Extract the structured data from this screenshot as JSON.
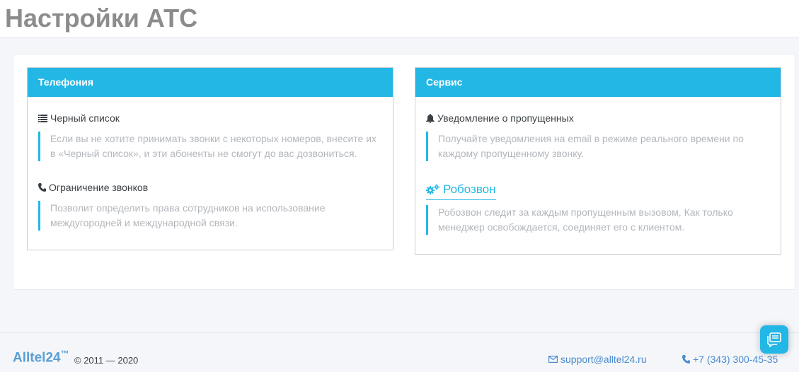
{
  "header": {
    "title": "Настройки АТС"
  },
  "telephony": {
    "heading": "Телефония",
    "items": [
      {
        "title": "Черный список",
        "icon": "list-icon",
        "description": "Если вы не хотите принимать звонки с некоторых номеров, внесите их в «Черный список», и эти абоненты не смогут до вас дозвониться."
      },
      {
        "title": "Ограничение звонков",
        "icon": "phone-icon",
        "description": "Позволит определить права сотрудников на использование междугородней и международной связи."
      }
    ]
  },
  "service": {
    "heading": "Сервис",
    "items": [
      {
        "title": "Уведомление о пропущенных",
        "icon": "bell-icon",
        "description": "Получайте уведомления на email в режиме реального времени по каждому пропущенному звонку."
      },
      {
        "title": "Робозвон",
        "icon": "gears-icon",
        "description": "Робозвон следит за каждым пропущенным вызовом, Как только менеджер освобождается, соединяет его с клиентом."
      }
    ]
  },
  "footer": {
    "brand": "Alltel24",
    "trademark": "™",
    "copyright": "© 2011 — 2020",
    "email": "support@alltel24.ru",
    "phone": "+7 (343) 300-45-35"
  },
  "colors": {
    "accent": "#23b7e5",
    "link": "#4a8bd0",
    "title": "#8c8c8c"
  }
}
